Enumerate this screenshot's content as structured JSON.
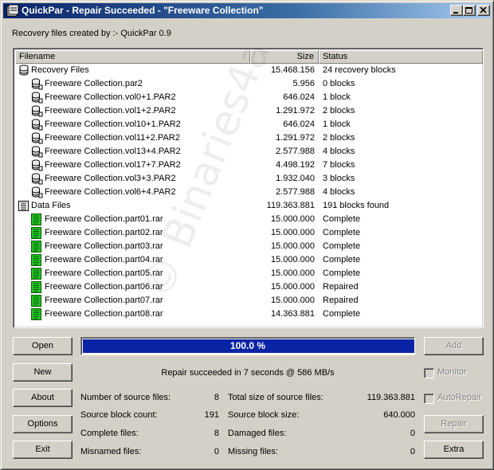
{
  "window": {
    "title": "QuickPar - Repair Succeeded - \"Freeware Collection\""
  },
  "created_by": "Recovery files created by :- QuickPar 0.9",
  "list": {
    "columns": {
      "filename": "Filename",
      "size": "Size",
      "status": "Status"
    },
    "rows": [
      {
        "level": 0,
        "icon": "recovery-group-icon",
        "name": "Recovery Files",
        "size": "15.468.156",
        "status": "24 recovery blocks"
      },
      {
        "level": 1,
        "icon": "par-file-icon",
        "name": "Freeware Collection.par2",
        "size": "5.956",
        "status": "0 blocks"
      },
      {
        "level": 1,
        "icon": "par-file-icon",
        "name": "Freeware Collection.vol0+1.PAR2",
        "size": "646.024",
        "status": "1 block"
      },
      {
        "level": 1,
        "icon": "par-file-icon",
        "name": "Freeware Collection.vol1+2.PAR2",
        "size": "1.291.972",
        "status": "2 blocks"
      },
      {
        "level": 1,
        "icon": "par-file-icon",
        "name": "Freeware Collection.vol10+1.PAR2",
        "size": "646.024",
        "status": "1 block"
      },
      {
        "level": 1,
        "icon": "par-file-icon",
        "name": "Freeware Collection.vol11+2.PAR2",
        "size": "1.291.972",
        "status": "2 blocks"
      },
      {
        "level": 1,
        "icon": "par-file-icon",
        "name": "Freeware Collection.vol13+4.PAR2",
        "size": "2.577.988",
        "status": "4 blocks"
      },
      {
        "level": 1,
        "icon": "par-file-icon",
        "name": "Freeware Collection.vol17+7.PAR2",
        "size": "4.498.192",
        "status": "7 blocks"
      },
      {
        "level": 1,
        "icon": "par-file-icon",
        "name": "Freeware Collection.vol3+3.PAR2",
        "size": "1.932.040",
        "status": "3 blocks"
      },
      {
        "level": 1,
        "icon": "par-file-icon",
        "name": "Freeware Collection.vol6+4.PAR2",
        "size": "2.577.988",
        "status": "4 blocks"
      },
      {
        "level": 0,
        "icon": "data-group-icon",
        "name": "Data Files",
        "size": "119.363.881",
        "status": "191 blocks found"
      },
      {
        "level": 1,
        "icon": "rar-file-icon",
        "name": "Freeware Collection.part01.rar",
        "size": "15.000.000",
        "status": "Complete"
      },
      {
        "level": 1,
        "icon": "rar-file-icon",
        "name": "Freeware Collection.part02.rar",
        "size": "15.000.000",
        "status": "Complete"
      },
      {
        "level": 1,
        "icon": "rar-file-icon",
        "name": "Freeware Collection.part03.rar",
        "size": "15.000.000",
        "status": "Complete"
      },
      {
        "level": 1,
        "icon": "rar-file-icon",
        "name": "Freeware Collection.part04.rar",
        "size": "15.000.000",
        "status": "Complete"
      },
      {
        "level": 1,
        "icon": "rar-file-icon",
        "name": "Freeware Collection.part05.rar",
        "size": "15.000.000",
        "status": "Complete"
      },
      {
        "level": 1,
        "icon": "rar-file-icon",
        "name": "Freeware Collection.part06.rar",
        "size": "15.000.000",
        "status": "Repaired"
      },
      {
        "level": 1,
        "icon": "rar-file-icon",
        "name": "Freeware Collection.part07.rar",
        "size": "15.000.000",
        "status": "Repaired"
      },
      {
        "level": 1,
        "icon": "rar-file-icon",
        "name": "Freeware Collection.part08.rar",
        "size": "14.363.881",
        "status": "Complete"
      }
    ]
  },
  "watermark": "© Binaries4all",
  "buttons": {
    "open": "Open",
    "new": "New",
    "about": "About",
    "options": "Options",
    "exit": "Exit",
    "add": "Add",
    "repair": "Repair",
    "extra": "Extra"
  },
  "progress": {
    "value": 1.0,
    "label": "100.0 %"
  },
  "status_message": "Repair succeeded in 7 seconds @ 586 MB/s",
  "checkboxes": {
    "monitor": "Monitor",
    "autorepair": "AutoRepair"
  },
  "stats": {
    "num_source_files_label": "Number of source files:",
    "num_source_files": "8",
    "source_block_count_label": "Source block count:",
    "source_block_count": "191",
    "complete_files_label": "Complete files:",
    "complete_files": "8",
    "misnamed_files_label": "Misnamed files:",
    "misnamed_files": "0",
    "total_size_label": "Total size of source files:",
    "total_size": "119.363.881",
    "source_block_size_label": "Source block size:",
    "source_block_size": "640.000",
    "damaged_files_label": "Damaged files:",
    "damaged_files": "0",
    "missing_files_label": "Missing files:",
    "missing_files": "0"
  },
  "colors": {
    "title_active": "#0a246a",
    "progress_fill": "#0b24a6",
    "rar_icon": "#22c422"
  }
}
